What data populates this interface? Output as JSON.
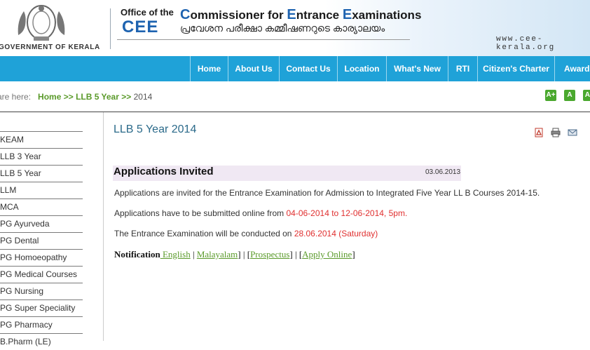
{
  "header": {
    "gov_label": "GOVERNMENT OF KERALA",
    "office_of": "Office of the",
    "cee": "CEE",
    "commissioner_parts": [
      "C",
      "ommissioner for ",
      "E",
      "ntrance ",
      "E",
      "xaminations"
    ],
    "malayalam": "പ്രവേശന പരീക്ഷാ കമ്മീഷണറുടെ കാര്യാലയം",
    "website": "www.cee-kerala.org"
  },
  "nav": {
    "items": [
      "Home",
      "About Us",
      "Contact Us",
      "Location",
      "What's New",
      "RTI",
      "Citizen's Charter",
      "Awards"
    ]
  },
  "breadcrumb": {
    "prefix": "are here:",
    "home": "Home",
    "sep1": ">>",
    "section": "LLB 5 Year",
    "sep2": ">>",
    "current": "2014"
  },
  "font_buttons": [
    "A+",
    "A",
    "A-"
  ],
  "sidebar": {
    "items": [
      "KEAM",
      "LLB 3 Year",
      "LLB 5 Year",
      "LLM",
      "MCA",
      "PG Ayurveda",
      "PG Dental",
      "PG Homoeopathy",
      "PG Medical Courses",
      "PG Nursing",
      "PG Super Speciality",
      "PG Pharmacy",
      "B.Pharm (LE)"
    ]
  },
  "content": {
    "title": "LLB 5 Year 2014",
    "heading": "Applications Invited",
    "date": "03.06.2013",
    "para1": "Applications are invited for the Entrance Examination for Admission to Integrated Five Year LL B Courses 2014-15.",
    "para2_text": "Applications have to be submitted online from ",
    "para2_dates": "04-06-2014 to 12-06-2014, 5pm.",
    "para3_text": "The Entrance Examination will be conducted on ",
    "para3_date": "28.06.2014 (Saturday)",
    "notif_label": "Notification",
    "notif_english": " English",
    "notif_sep1": " | ",
    "notif_malayalam": " Malayalam",
    "notif_sep2": "] | [",
    "notif_prospectus": "Prospectus",
    "notif_sep3": "] | [",
    "notif_apply": "Apply Online",
    "notif_end": "]"
  },
  "icons": [
    "pdf-icon",
    "print-icon",
    "email-icon"
  ],
  "colors": {
    "nav_bg": "#1fa2d8",
    "link_green": "#5a9a2a",
    "title_blue": "#2b6a8a",
    "date_red": "#e03030"
  }
}
